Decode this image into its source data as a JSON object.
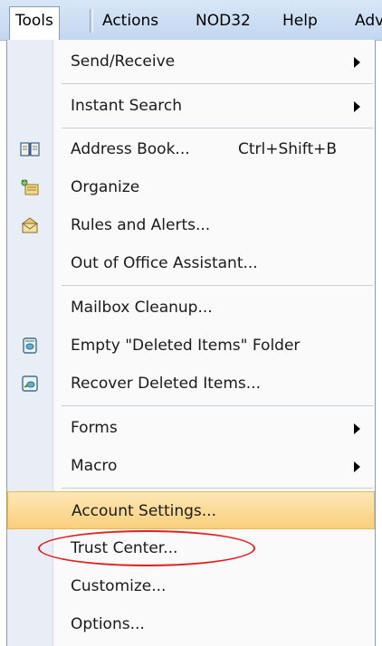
{
  "menubar": {
    "items": [
      "Tools",
      "Actions",
      "NOD32",
      "Help",
      "Adv"
    ]
  },
  "menu": {
    "items": [
      {
        "label": "Send/Receive",
        "submenu": true
      },
      {
        "label": "Instant Search",
        "submenu": true
      },
      {
        "label": "Address Book...",
        "shortcut": "Ctrl+Shift+B",
        "icon": "address-book-icon"
      },
      {
        "label": "Organize",
        "icon": "organize-icon"
      },
      {
        "label": "Rules and Alerts...",
        "icon": "rules-alerts-icon"
      },
      {
        "label": "Out of Office Assistant..."
      },
      {
        "label": "Mailbox Cleanup..."
      },
      {
        "label": "Empty \"Deleted Items\" Folder",
        "icon": "empty-trash-icon"
      },
      {
        "label": "Recover Deleted Items...",
        "icon": "recover-deleted-icon"
      },
      {
        "label": "Forms",
        "submenu": true
      },
      {
        "label": "Macro",
        "submenu": true
      },
      {
        "label": "Account Settings...",
        "highlighted": true
      },
      {
        "label": "Trust Center..."
      },
      {
        "label": "Customize..."
      },
      {
        "label": "Options..."
      }
    ]
  },
  "colors": {
    "menubar": "#c2d7f0",
    "highlight": "#f9cf7c",
    "annotation": "#e02020"
  }
}
